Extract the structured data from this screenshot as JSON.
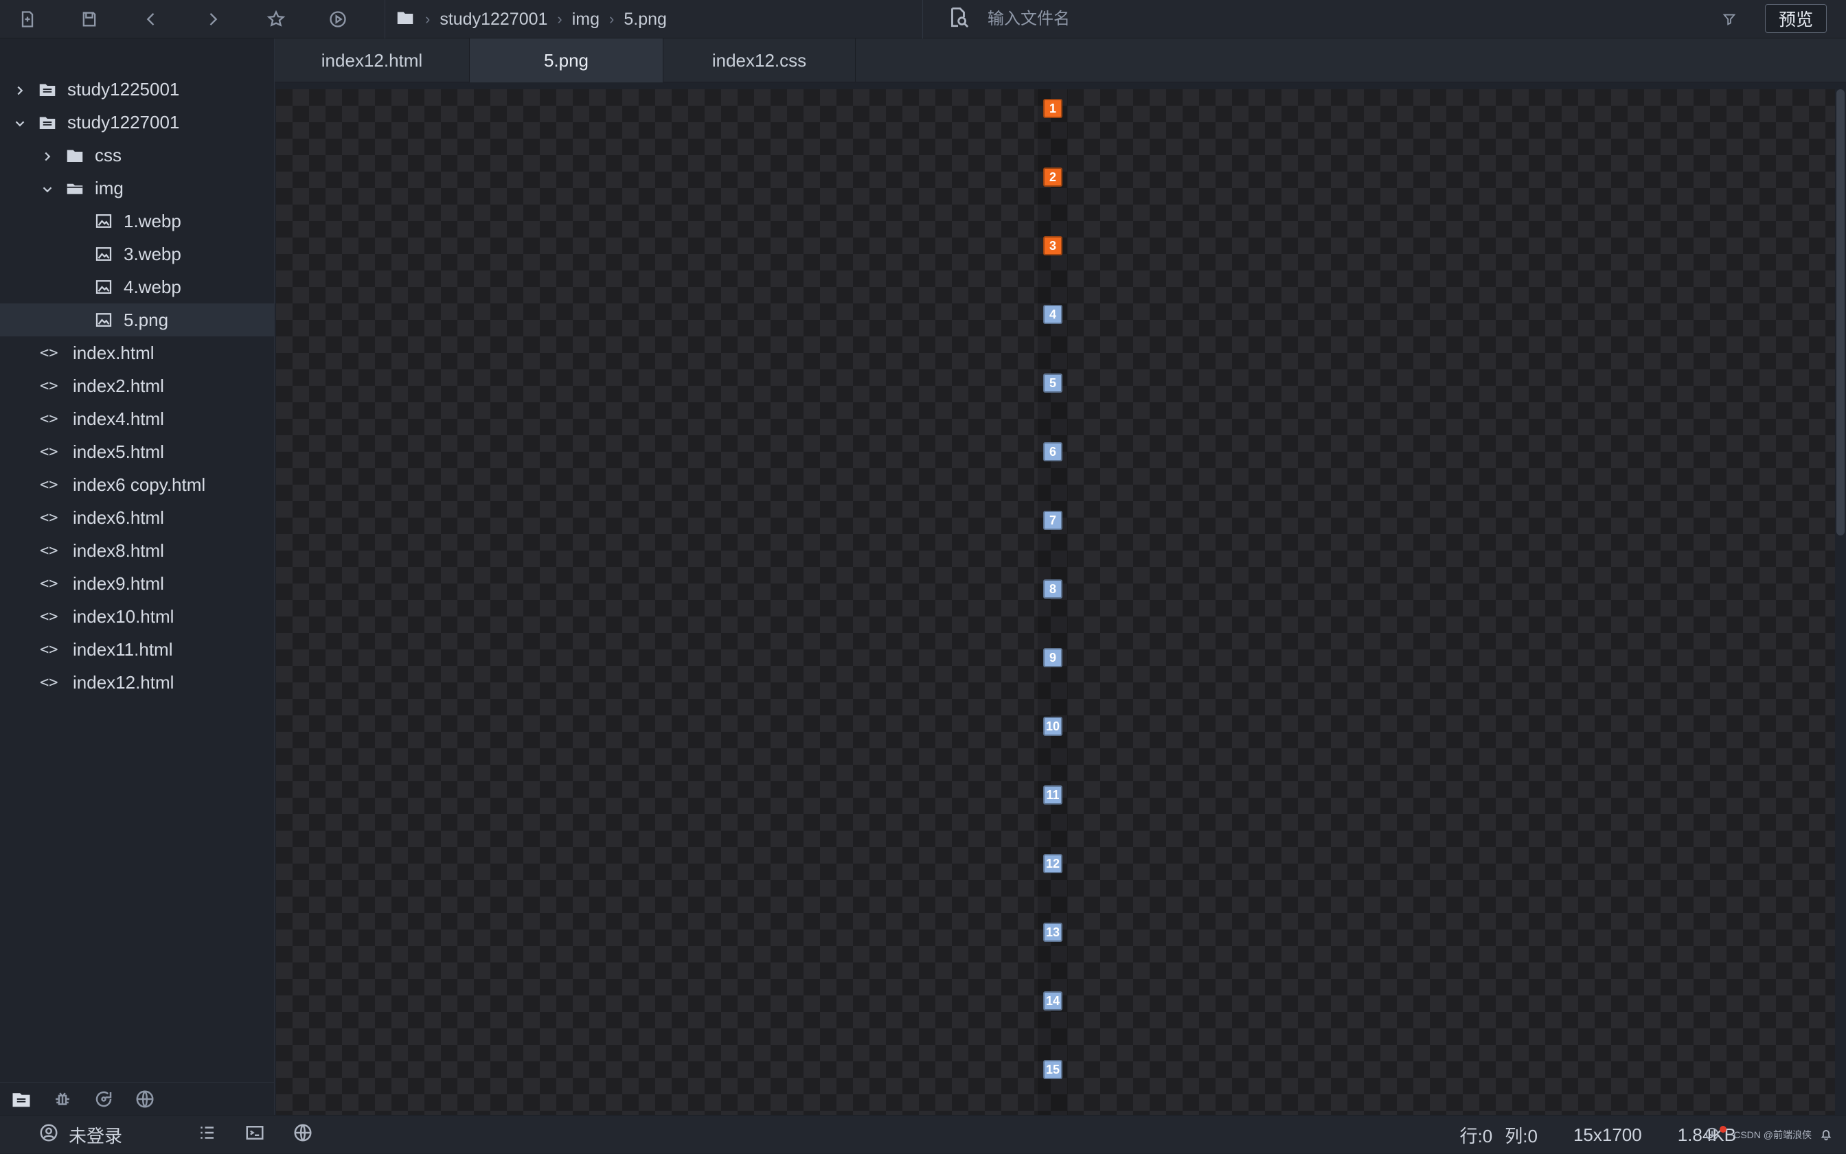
{
  "breadcrumb": {
    "items": [
      "study1227001",
      "img",
      "5.png"
    ]
  },
  "search": {
    "placeholder": "输入文件名"
  },
  "toolbar": {
    "preview_label": "预览"
  },
  "file_tree": {
    "items": [
      {
        "label": "study1225001"
      },
      {
        "label": "study1227001"
      },
      {
        "label": "css"
      },
      {
        "label": "img"
      },
      {
        "label": "1.webp"
      },
      {
        "label": "3.webp"
      },
      {
        "label": "4.webp"
      },
      {
        "label": "5.png"
      },
      {
        "label": "index.html"
      },
      {
        "label": "index2.html"
      },
      {
        "label": "index4.html"
      },
      {
        "label": "index5.html"
      },
      {
        "label": "index6 copy.html"
      },
      {
        "label": "index6.html"
      },
      {
        "label": "index8.html"
      },
      {
        "label": "index9.html"
      },
      {
        "label": "index10.html"
      },
      {
        "label": "index11.html"
      },
      {
        "label": "index12.html"
      }
    ]
  },
  "tabs": [
    {
      "label": "index12.html"
    },
    {
      "label": "5.png"
    },
    {
      "label": "index12.css"
    }
  ],
  "sprite": {
    "numbers": [
      "1",
      "2",
      "3",
      "4",
      "5",
      "6",
      "7",
      "8",
      "9",
      "10",
      "11",
      "12",
      "13",
      "14",
      "15"
    ]
  },
  "status": {
    "user_label": "未登录",
    "line_label": "行:0",
    "col_label": "列:0",
    "image_size": "15x1700",
    "file_size": "1.84KB",
    "watermark": "CSDN @前端浪侠"
  },
  "colors": {
    "orange": "#f36a1d",
    "blue": "#8fb1df"
  }
}
